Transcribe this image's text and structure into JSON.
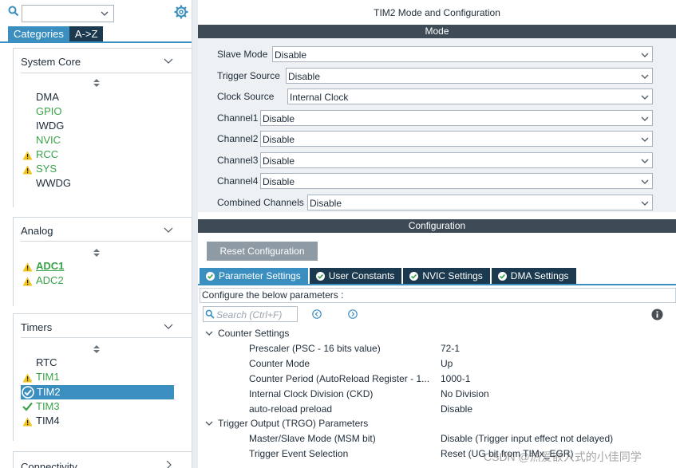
{
  "sidebar": {
    "search": {
      "value": ""
    },
    "tabs": [
      "Categories",
      "A->Z"
    ],
    "categories": [
      {
        "title": "System Core",
        "items": [
          {
            "label": "DMA",
            "state": "normal"
          },
          {
            "label": "GPIO",
            "state": "enabled"
          },
          {
            "label": "IWDG",
            "state": "normal"
          },
          {
            "label": "NVIC",
            "state": "enabled"
          },
          {
            "label": "RCC",
            "state": "warning"
          },
          {
            "label": "SYS",
            "state": "warning"
          },
          {
            "label": "WWDG",
            "state": "normal"
          }
        ]
      },
      {
        "title": "Analog",
        "items": [
          {
            "label": "ADC1",
            "state": "warning"
          },
          {
            "label": "ADC2",
            "state": "warning"
          }
        ]
      },
      {
        "title": "Timers",
        "items": [
          {
            "label": "RTC",
            "state": "normal"
          },
          {
            "label": "TIM1",
            "state": "warning"
          },
          {
            "label": "TIM2",
            "state": "selected"
          },
          {
            "label": "TIM3",
            "state": "ok"
          },
          {
            "label": "TIM4",
            "state": "warning"
          }
        ]
      },
      {
        "title": "Connectivity",
        "items": []
      }
    ]
  },
  "main": {
    "title": "TIM2 Mode and Configuration",
    "mode_header": "Mode",
    "mode_fields": [
      {
        "label": "Slave Mode",
        "value": "Disable"
      },
      {
        "label": "Trigger Source",
        "value": "Disable"
      },
      {
        "label": "Clock Source",
        "value": "Internal Clock"
      },
      {
        "label": "Channel1",
        "value": "Disable"
      },
      {
        "label": "Channel2",
        "value": "Disable"
      },
      {
        "label": "Channel3",
        "value": "Disable"
      },
      {
        "label": "Channel4",
        "value": "Disable"
      },
      {
        "label": "Combined Channels",
        "value": "Disable"
      }
    ],
    "config_header": "Configuration",
    "reset_button": "Reset Configuration",
    "config_tabs": [
      "Parameter Settings",
      "User Constants",
      "NVIC Settings",
      "DMA Settings"
    ],
    "configure_text": "Configure the below parameters :",
    "search_placeholder": "Search (Ctrl+F)",
    "groups": [
      {
        "title": "Counter Settings",
        "params": [
          {
            "name": "Prescaler (PSC - 16 bits value)",
            "value": "72-1"
          },
          {
            "name": "Counter Mode",
            "value": "Up"
          },
          {
            "name": "Counter Period (AutoReload Register - 1...",
            "value": "1000-1"
          },
          {
            "name": "Internal Clock Division (CKD)",
            "value": "No Division"
          },
          {
            "name": "auto-reload preload",
            "value": "Disable"
          }
        ]
      },
      {
        "title": "Trigger Output (TRGO) Parameters",
        "params": [
          {
            "name": "Master/Slave Mode (MSM bit)",
            "value": "Disable (Trigger input effect not delayed)"
          },
          {
            "name": "Trigger Event Selection",
            "value": "Reset (UG bit from TIMx_EGR)"
          }
        ]
      }
    ]
  },
  "watermark": "CSDN @热爱嵌入式的小佳同学",
  "colors": {
    "accent": "#3a8fc0",
    "dark_tab": "#1c3a4f",
    "header_bar": "#3e4b56",
    "enabled_green": "#3aa24a",
    "warning_yellow": "#f0c419"
  }
}
